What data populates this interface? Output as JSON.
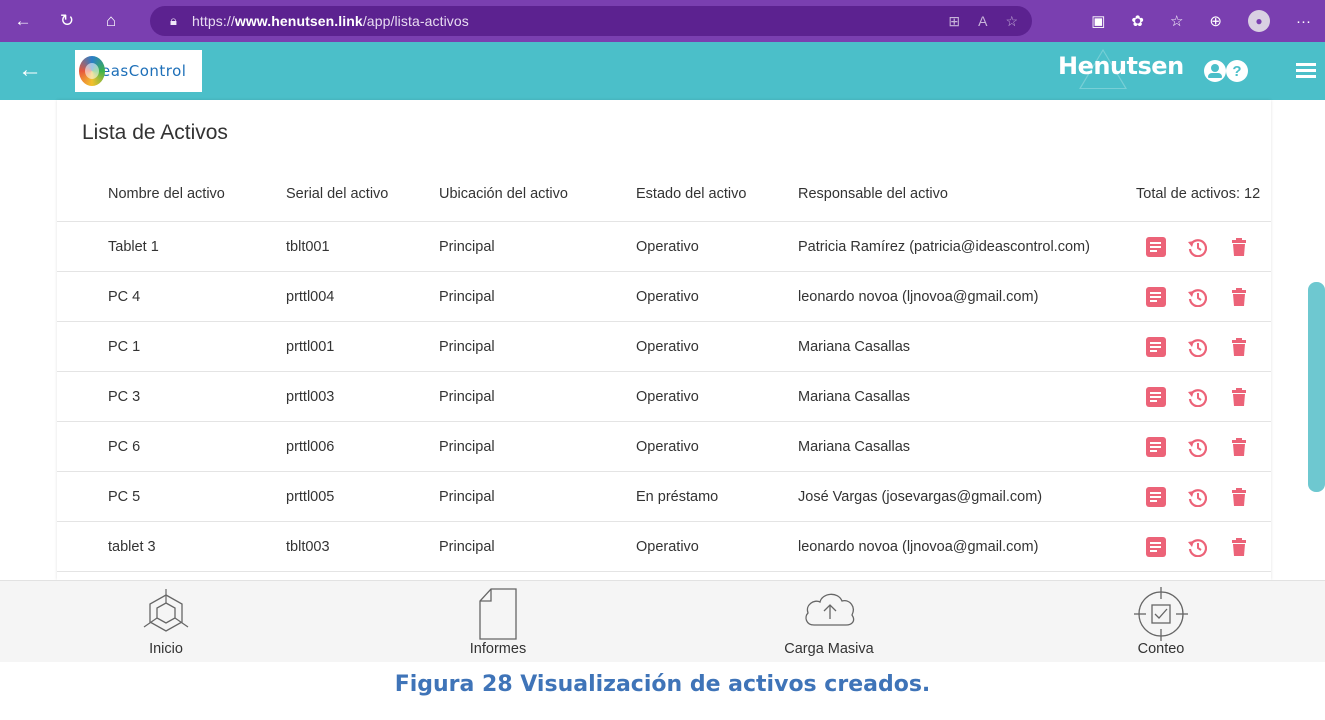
{
  "browser": {
    "url_prefix": "https://",
    "url_host": "www.henutsen.link",
    "url_path": "/app/lista-activos"
  },
  "header": {
    "logo_text": "easControl",
    "brand": "Henutsen"
  },
  "page": {
    "title": "Lista de Activos",
    "columns": [
      "Nombre del activo",
      "Serial del activo",
      "Ubicación del activo",
      "Estado del activo",
      "Responsable del activo"
    ],
    "total_label": "Total de activos: 12",
    "rows": [
      {
        "name": "Tablet 1",
        "serial": "tblt001",
        "location": "Principal",
        "status": "Operativo",
        "owner": "Patricia Ramírez (patricia@ideascontrol.com)"
      },
      {
        "name": "PC 4",
        "serial": "prttl004",
        "location": "Principal",
        "status": "Operativo",
        "owner": "leonardo novoa (ljnovoa@gmail.com)"
      },
      {
        "name": "PC 1",
        "serial": "prttl001",
        "location": "Principal",
        "status": "Operativo",
        "owner": "Mariana Casallas"
      },
      {
        "name": "PC 3",
        "serial": "prttl003",
        "location": "Principal",
        "status": "Operativo",
        "owner": "Mariana Casallas"
      },
      {
        "name": "PC 6",
        "serial": "prttl006",
        "location": "Principal",
        "status": "Operativo",
        "owner": "Mariana Casallas"
      },
      {
        "name": "PC 5",
        "serial": "prttl005",
        "location": "Principal",
        "status": "En préstamo",
        "owner": "José Vargas (josevargas@gmail.com)"
      },
      {
        "name": "tablet 3",
        "serial": "tblt003",
        "location": "Principal",
        "status": "Operativo",
        "owner": "leonardo novoa (ljnovoa@gmail.com)"
      }
    ],
    "row_actions": [
      "detail-icon",
      "history-icon",
      "trash-icon"
    ]
  },
  "bottom_nav": {
    "items": [
      {
        "label": "Inicio",
        "icon": "cube-icon"
      },
      {
        "label": "Informes",
        "icon": "document-icon"
      },
      {
        "label": "Carga Masiva",
        "icon": "cloud-upload-icon"
      },
      {
        "label": "Conteo",
        "icon": "target-check-icon"
      }
    ]
  },
  "caption": "Figura 28 Visualización de activos creados.",
  "colors": {
    "browser": "#7a3fb0",
    "header": "#4bbfc9",
    "action": "#ec6378",
    "caption": "#3f74b8"
  }
}
